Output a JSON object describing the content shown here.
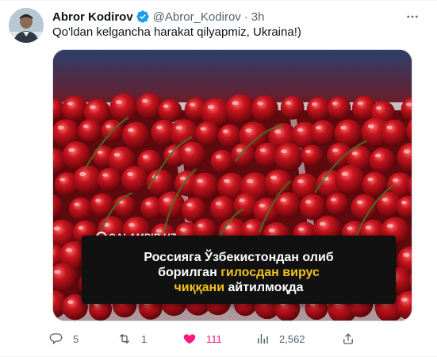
{
  "tweet": {
    "author": {
      "display_name": "Abror Kodirov",
      "handle": "@Abror_Kodirov",
      "verified": true,
      "avatar_icon": "user-avatar-photo"
    },
    "separator": "·",
    "time": "3h",
    "text": "Qo'ldan kelgancha harakat qilyapmiz, Ukraina!)",
    "media": {
      "description_icon": "cherries-photo",
      "brand": "QALAMPIR.UZ",
      "caption": {
        "line1": "Россияга Ўзбекистондан олиб",
        "line2_plain": "борилган ",
        "line2_highlight": "гилосдан вирус",
        "line3_highlight": "чиққани",
        "line3_plain": " айтилмоқда"
      },
      "colors": {
        "highlight": "#f2c21b",
        "caption_bg": "#111111",
        "cherry": "#b5121b"
      }
    },
    "actions": {
      "replies": "5",
      "retweets": "1",
      "likes": "111",
      "views": "2,562"
    },
    "colors": {
      "verified": "#1d9bf0",
      "like": "#f91880",
      "secondary_text": "#536471"
    }
  }
}
